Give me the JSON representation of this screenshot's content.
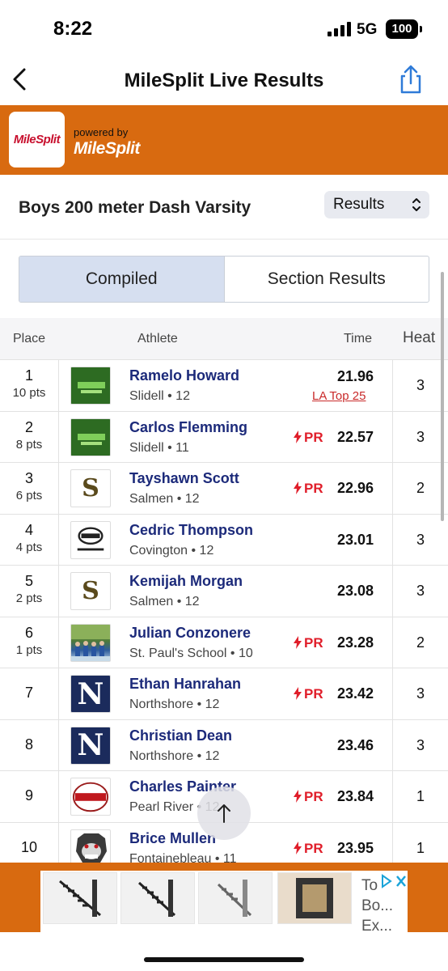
{
  "status_bar": {
    "time": "8:22",
    "network": "5G",
    "battery": "100"
  },
  "nav": {
    "title": "MileSplit Live Results"
  },
  "brand": {
    "logo_text": "MileSplit",
    "powered_by": "powered by",
    "powered_brand": "MileSplit"
  },
  "event": {
    "title": "Boys 200 meter Dash Varsity",
    "view_select": "Results"
  },
  "tabs": [
    {
      "label": "Compiled",
      "active": true
    },
    {
      "label": "Section Results",
      "active": false
    }
  ],
  "table": {
    "headers": {
      "place": "Place",
      "athlete": "Athlete",
      "time": "Time",
      "heat": "Heat"
    },
    "rows": [
      {
        "place": "1",
        "pts": "10 pts",
        "name": "Ramelo Howard",
        "school": "Slidell • 12",
        "time": "21.96",
        "pr": "",
        "note": "LA Top 25",
        "heat": "3",
        "image": "slidell-logo"
      },
      {
        "place": "2",
        "pts": "8 pts",
        "name": "Carlos Flemming",
        "school": "Slidell • 11",
        "time": "22.57",
        "pr": "PR",
        "note": "",
        "heat": "3",
        "image": "slidell-logo"
      },
      {
        "place": "3",
        "pts": "6 pts",
        "name": "Tayshawn Scott",
        "school": "Salmen • 12",
        "time": "22.96",
        "pr": "PR",
        "note": "",
        "heat": "2",
        "image": "salmen-logo"
      },
      {
        "place": "4",
        "pts": "4 pts",
        "name": "Cedric Thompson",
        "school": "Covington • 12",
        "time": "23.01",
        "pr": "",
        "note": "",
        "heat": "3",
        "image": "covington-logo"
      },
      {
        "place": "5",
        "pts": "2 pts",
        "name": "Kemijah Morgan",
        "school": "Salmen • 12",
        "time": "23.08",
        "pr": "",
        "note": "",
        "heat": "3",
        "image": "salmen-logo"
      },
      {
        "place": "6",
        "pts": "1 pts",
        "name": "Julian Conzonere",
        "school": "St. Paul's School • 10",
        "time": "23.28",
        "pr": "PR",
        "note": "",
        "heat": "2",
        "image": "team-photo"
      },
      {
        "place": "7",
        "pts": "",
        "name": "Ethan Hanrahan",
        "school": "Northshore • 12",
        "time": "23.42",
        "pr": "PR",
        "note": "",
        "heat": "3",
        "image": "northshore-logo"
      },
      {
        "place": "8",
        "pts": "",
        "name": "Christian Dean",
        "school": "Northshore • 12",
        "time": "23.46",
        "pr": "",
        "note": "",
        "heat": "3",
        "image": "northshore-logo"
      },
      {
        "place": "9",
        "pts": "",
        "name": "Charles Painter",
        "school": "Pearl River • 12",
        "time": "23.84",
        "pr": "PR",
        "note": "",
        "heat": "1",
        "image": "pearl-river-logo"
      },
      {
        "place": "10",
        "pts": "",
        "name": "Brice Mullen",
        "school": "Fontainebleau • 11",
        "time": "23.95",
        "pr": "PR",
        "note": "",
        "heat": "1",
        "image": "bulldog-logo"
      }
    ]
  },
  "ad": {
    "text_lines": [
      "To",
      "Bo...",
      "Ex..."
    ]
  },
  "colors": {
    "brand_orange": "#d86a10",
    "link_navy": "#1c2a7a",
    "pr_red": "#e01e2a",
    "tab_active": "#d6dff0"
  },
  "icons": {
    "back": "chevron-left-icon",
    "share": "share-icon",
    "select": "updown-chevron-icon",
    "pr": "lightning-icon",
    "scroll_top": "arrow-up-icon"
  }
}
